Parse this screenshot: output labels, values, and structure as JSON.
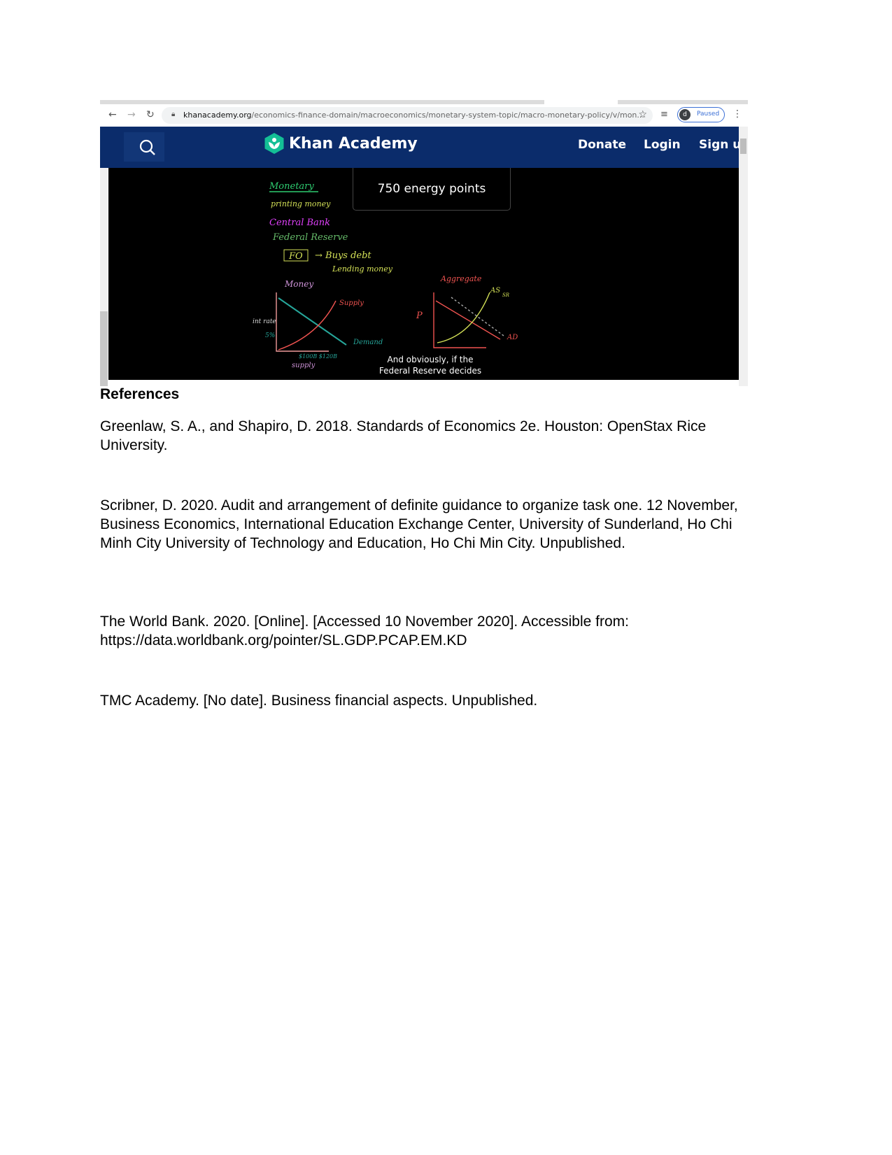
{
  "browser": {
    "url_domain": "khanacademy.org",
    "url_path": "/economics-finance-domain/macroeconomics/monetary-system-topic/macro-monetary-policy/v/mon...",
    "profile_initial": "d",
    "profile_status": "Paused"
  },
  "khan": {
    "brand": "Khan Academy",
    "nav": [
      "Donate",
      "Login",
      "Sign up"
    ],
    "colors": {
      "header": "#0b2c6b",
      "logo": "#14bf96"
    }
  },
  "video": {
    "energy_points": "750 energy points",
    "caption_line1": "And obviously, if the",
    "caption_line2": "Federal Reserve decides",
    "board": {
      "monetary": "Monetary",
      "printing": "printing money",
      "central_bank": "Central Bank",
      "fed": "Federal Reserve",
      "fomc": "FO",
      "buys_debt": "→ Buys debt",
      "lending": "Lending money",
      "money": "Money",
      "supply": "Supply",
      "demand": "Demand",
      "int_rate": "int rate",
      "pct": "5%",
      "x_ticks": "$100B $120B",
      "x_label": "supply",
      "aggregate": "Aggregate",
      "p": "P",
      "as": "AS",
      "sr": "SR",
      "ad": "AD"
    }
  },
  "document": {
    "heading": "References",
    "references": [
      "Greenlaw, S. A., and Shapiro, D. 2018. Standards of Economics 2e. Houston: OpenStax Rice University.",
      "Scribner, D. 2020. Audit and arrangement of definite guidance to organize task one. 12 November, Business Economics, International Education Exchange Center, University of Sunderland, Ho Chi Minh City University of Technology and Education, Ho Chi Min City. Unpublished.",
      "The World Bank. 2020. [Online]. [Accessed 10 November 2020]. Accessible from: https://data.worldbank.org/pointer/SL.GDP.PCAP.EM.KD",
      "TMC Academy. [No date]. Business financial aspects. Unpublished."
    ]
  }
}
